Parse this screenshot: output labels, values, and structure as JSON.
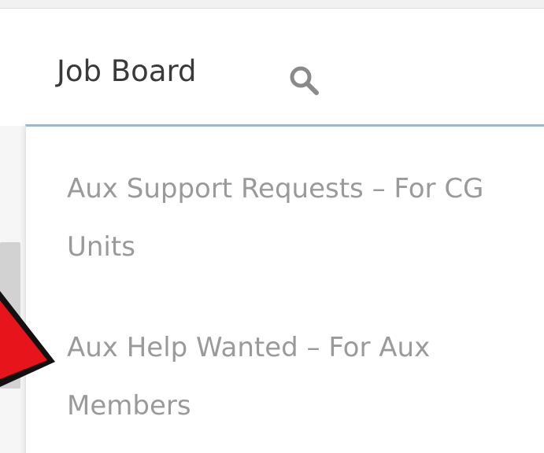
{
  "nav": {
    "job_board_label": "Job Board",
    "search_icon": "search-icon"
  },
  "dropdown": {
    "items": [
      {
        "label": "Aux Support Requests – For CG Units"
      },
      {
        "label": "Aux Help Wanted – For Aux Members"
      }
    ]
  },
  "annotation": {
    "arrow_color": "#e8141b",
    "arrow_outline": "#111111",
    "icon": "red-arrow-annotation"
  },
  "colors": {
    "nav_text": "#3a3a3a",
    "menu_text": "#9a9a9a",
    "dropdown_accent": "#9ab8cf"
  }
}
